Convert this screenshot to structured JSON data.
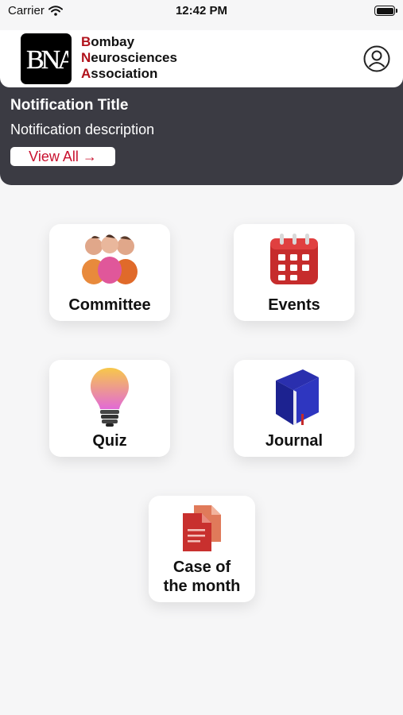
{
  "status_bar": {
    "carrier": "Carrier",
    "time": "12:42 PM"
  },
  "header": {
    "logo_lines": [
      {
        "initial": "B",
        "rest": "ombay"
      },
      {
        "initial": "N",
        "rest": "eurosciences"
      },
      {
        "initial": "A",
        "rest": "ssociation"
      }
    ]
  },
  "notification": {
    "title": "Notification Title",
    "description": "Notification description",
    "view_all_label": "View All",
    "arrow": "→"
  },
  "tiles": {
    "committee": "Committee",
    "events": "Events",
    "quiz": "Quiz",
    "journal": "Journal",
    "case_line1": "Case of",
    "case_line2": "the month"
  },
  "colors": {
    "brand_red": "#b0121b",
    "panel_dark": "#3b3b43",
    "link_red": "#c8102e"
  },
  "icons": [
    "wifi-icon",
    "battery-icon",
    "profile-icon",
    "people-icon",
    "calendar-icon",
    "lightbulb-icon",
    "book-icon",
    "document-icon",
    "arrow-right-icon"
  ]
}
